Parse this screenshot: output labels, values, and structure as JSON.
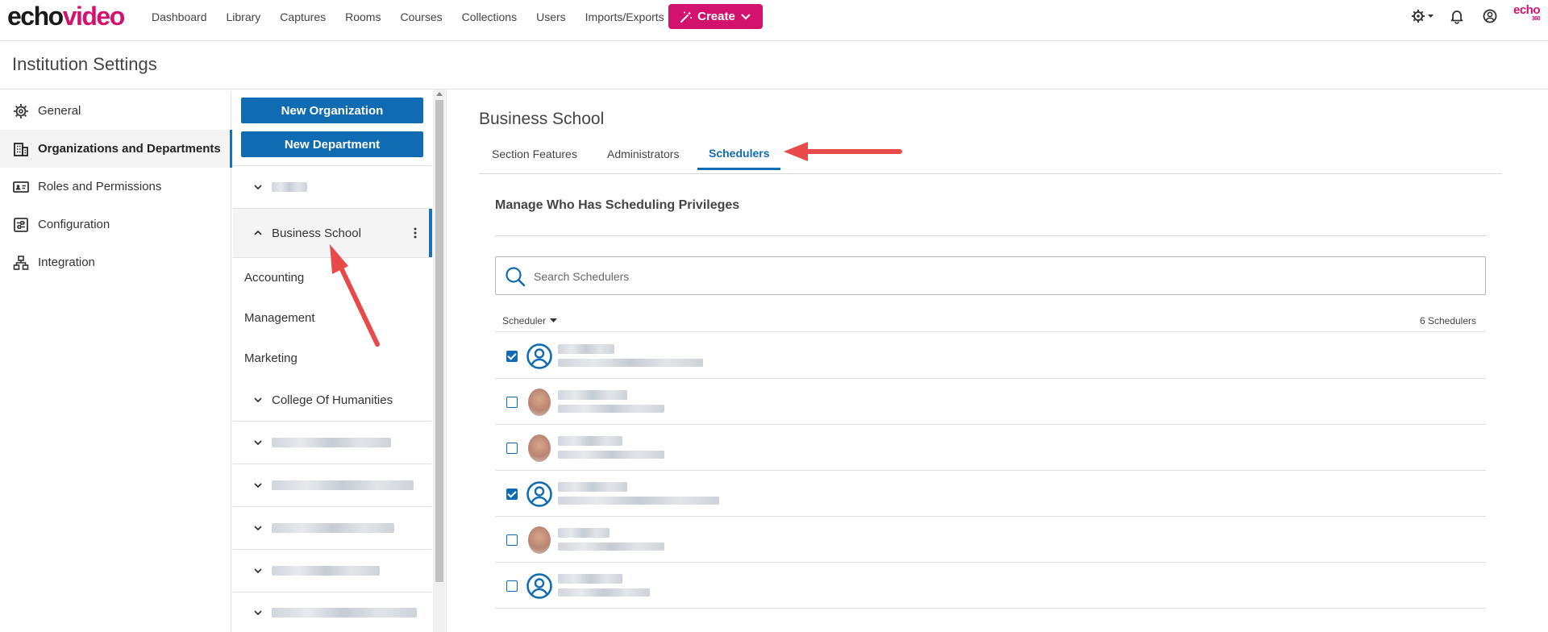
{
  "app": {
    "logo_part1": "echo",
    "logo_part2": "video",
    "brand_mini_top": "echo",
    "brand_mini_bottom": "360",
    "colors": {
      "brand": "#d3126d",
      "primary": "#0f6bb2",
      "annotation": "#e84a4a"
    }
  },
  "nav": {
    "items": [
      "Dashboard",
      "Library",
      "Captures",
      "Rooms",
      "Courses",
      "Collections",
      "Users",
      "Imports/Exports"
    ],
    "create_label": "Create",
    "icons": [
      "gear-icon",
      "bell-icon",
      "account-icon"
    ]
  },
  "page": {
    "title": "Institution Settings"
  },
  "settings_menu": {
    "items": [
      {
        "label": "General",
        "icon": "gear-icon"
      },
      {
        "label": "Organizations and Departments",
        "icon": "building-icon"
      },
      {
        "label": "Roles and Permissions",
        "icon": "id-card-icon"
      },
      {
        "label": "Configuration",
        "icon": "sliders-icon"
      },
      {
        "label": "Integration",
        "icon": "network-icon"
      }
    ],
    "active_index": 1
  },
  "tree": {
    "new_org_label": "New Organization",
    "new_dept_label": "New Department",
    "selected_org": "Business School",
    "departments": [
      "Accounting",
      "Management",
      "Marketing"
    ],
    "next_org": "College Of Humanities"
  },
  "main": {
    "title": "Business School",
    "tabs": [
      "Section Features",
      "Administrators",
      "Schedulers"
    ],
    "active_tab": 2,
    "section_heading": "Manage Who Has Scheduling Privileges",
    "search_placeholder": "Search Schedulers",
    "list_sort_label": "Scheduler",
    "list_count": "6 Schedulers",
    "schedulers": [
      {
        "checked": true,
        "avatar": "default"
      },
      {
        "checked": false,
        "avatar": "photo"
      },
      {
        "checked": false,
        "avatar": "photo"
      },
      {
        "checked": true,
        "avatar": "default"
      },
      {
        "checked": false,
        "avatar": "photo"
      },
      {
        "checked": false,
        "avatar": "default"
      }
    ]
  }
}
